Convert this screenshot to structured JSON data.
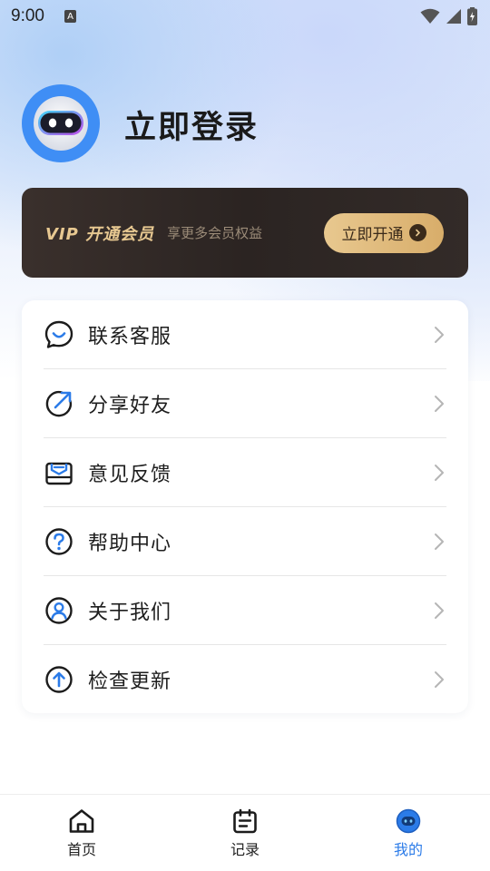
{
  "status_bar": {
    "time": "9:00",
    "notification_letter": "A"
  },
  "profile": {
    "login_label": "立即登录"
  },
  "vip": {
    "title": "VIP 开通会员",
    "subtitle": "享更多会员权益",
    "button_label": "立即开通"
  },
  "menu": [
    {
      "label": "联系客服",
      "icon": "customer-service-icon"
    },
    {
      "label": "分享好友",
      "icon": "share-icon"
    },
    {
      "label": "意见反馈",
      "icon": "feedback-icon"
    },
    {
      "label": "帮助中心",
      "icon": "help-icon"
    },
    {
      "label": "关于我们",
      "icon": "about-us-icon"
    },
    {
      "label": "检查更新",
      "icon": "update-icon"
    }
  ],
  "bottom_nav": [
    {
      "label": "首页",
      "icon": "home-icon",
      "active": false
    },
    {
      "label": "记录",
      "icon": "records-icon",
      "active": false
    },
    {
      "label": "我的",
      "icon": "profile-icon",
      "active": true
    }
  ],
  "colors": {
    "accent": "#2b7be8",
    "vip_gold": "#e7c891",
    "vip_bg": "#2b2422"
  }
}
